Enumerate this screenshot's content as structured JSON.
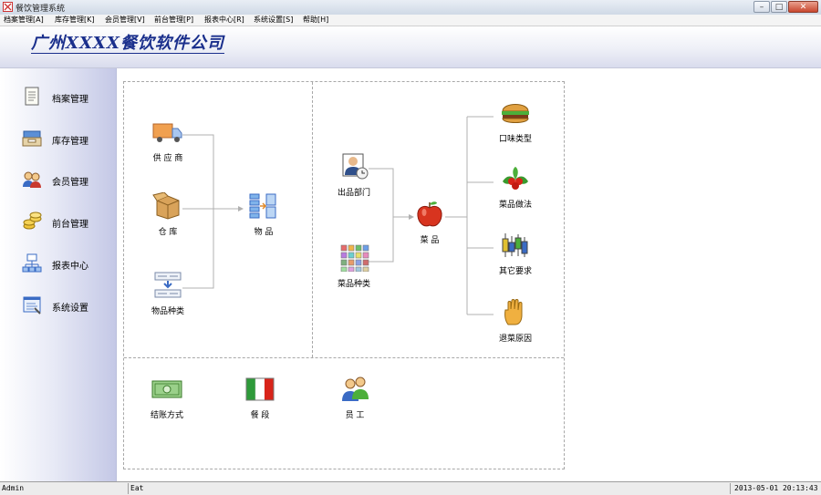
{
  "window": {
    "title": "餐饮管理系统",
    "controls": [
      "–",
      "□",
      "✕"
    ]
  },
  "menu": [
    "档案管理[A]",
    "库存管理[K]",
    "会员管理[V]",
    "前台管理[P]",
    "报表中心[R]",
    "系统设置[S]",
    "帮助[H]"
  ],
  "banner": {
    "company": "广州XXXX餐饮软件公司"
  },
  "sidebar": {
    "items": [
      {
        "label": "档案管理",
        "icon": "document-icon"
      },
      {
        "label": "库存管理",
        "icon": "inbox-tray-icon"
      },
      {
        "label": "会员管理",
        "icon": "members-icon"
      },
      {
        "label": "前台管理",
        "icon": "coins-icon"
      },
      {
        "label": "报表中心",
        "icon": "report-center-icon"
      },
      {
        "label": "系统设置",
        "icon": "settings-form-icon"
      }
    ]
  },
  "diagram": {
    "supplier": "供 应 商",
    "warehouse": "仓   库",
    "item_category": "物品种类",
    "items": "物   品",
    "output_department": "出品部门",
    "dish_category": "菜品种类",
    "dish": "菜   品",
    "taste": "口味类型",
    "cooking_method": "菜品做法",
    "other_requirements": "其它要求",
    "return_reason": "退菜原因",
    "payment_method": "结账方式",
    "meal_period": "餐   段",
    "staff": "员   工"
  },
  "status_bar": {
    "user": "Admin",
    "mode": "Eat",
    "datetime": "2013-05-01  20:13:43"
  },
  "colors": {
    "banner_text": "#1a2f8c",
    "connector": "#b0b0b0",
    "close_button": "#c9472e"
  }
}
